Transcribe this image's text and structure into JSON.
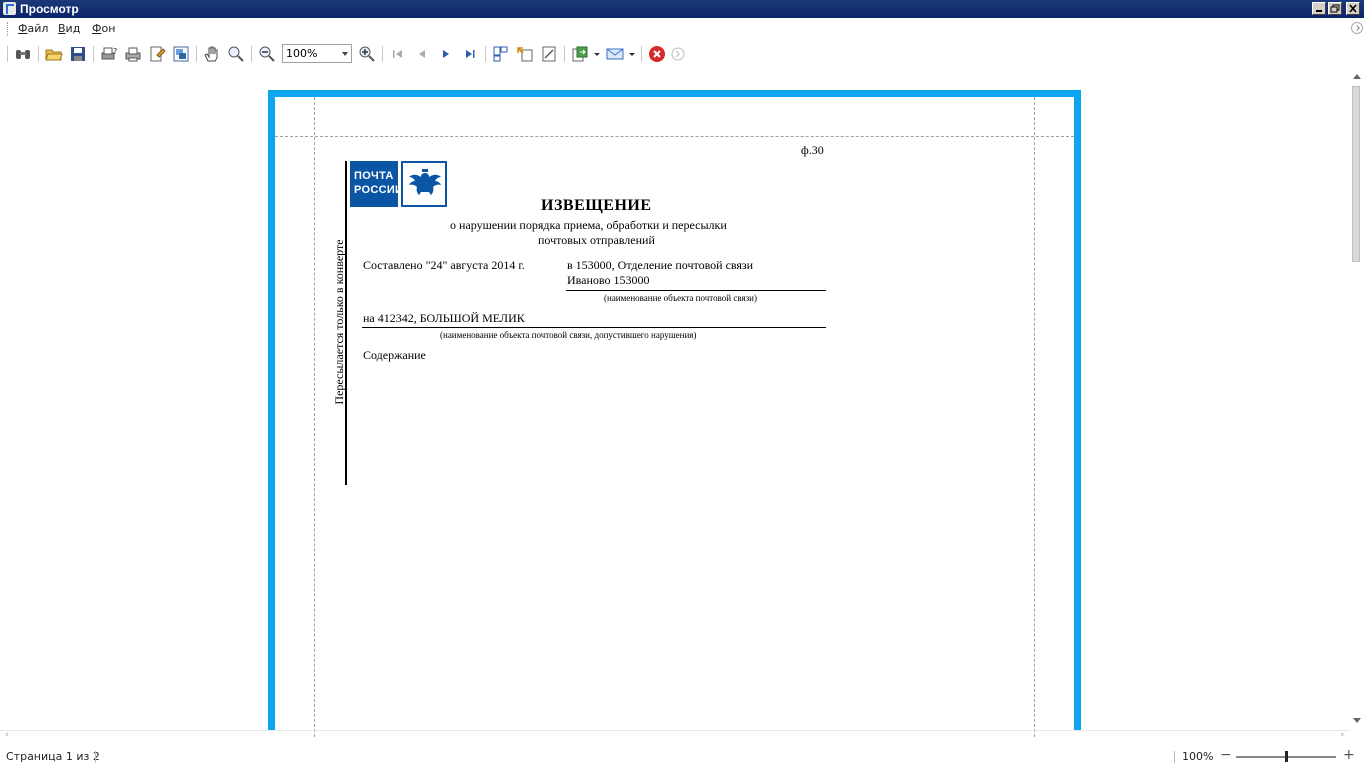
{
  "window": {
    "title": "Просмотр"
  },
  "menu": {
    "file": {
      "label": "Файл",
      "mnemonic": "Ф",
      "rest": "айл"
    },
    "view": {
      "label": "Вид",
      "mnemonic": "В",
      "rest": "ид"
    },
    "background": {
      "label": "Фон",
      "mnemonic": "Ф",
      "rest": "он"
    }
  },
  "toolbar": {
    "zoom_value": "100%",
    "icons": [
      "find-icon",
      "open-icon",
      "save-icon",
      "print-setup-icon",
      "print-icon",
      "page-setup-icon",
      "watermark-icon",
      "hand-tool-icon",
      "zoom-tool-icon",
      "zoom-out-icon",
      "zoom-in-icon",
      "first-page-icon",
      "prev-page-icon",
      "next-page-icon",
      "last-page-icon",
      "multipage-icon",
      "scale-icon",
      "edit-page-icon",
      "export-icon",
      "send-email-icon",
      "close-preview-icon",
      "help-icon"
    ]
  },
  "document": {
    "form_number": "ф.30",
    "vertical_note": "Пересылается только в конверте",
    "logo_text_line1": "ПОЧТА",
    "logo_text_line2": "РОССИИ",
    "title": "ИЗВЕЩЕНИЕ",
    "subtitle_line1": "о нарушении порядка приема, обработки и пересылки",
    "subtitle_line2": "почтовых отправлений",
    "composed": "Составлено \"24\" августа 2014 г.",
    "office_line1": "в 153000, Отделение почтовой связи",
    "office_line2": "Иваново 153000",
    "office_caption": "(наименование объекта почтовой связи)",
    "violator": "на 412342, БОЛЬШОЙ МЕЛИК",
    "violator_caption": "(наименование объекта почтовой связи, допустившего нарушения)",
    "content_label": "Содержание"
  },
  "colors": {
    "page_border": "#0aa6ef",
    "titlebar": "#0a246a",
    "logo": "#0a56a5"
  },
  "status": {
    "page_info": "Страница 1 из 2",
    "zoom": "100%",
    "zoom_minus": "−",
    "zoom_plus": "+",
    "zoom_level_fraction": 0.5
  }
}
